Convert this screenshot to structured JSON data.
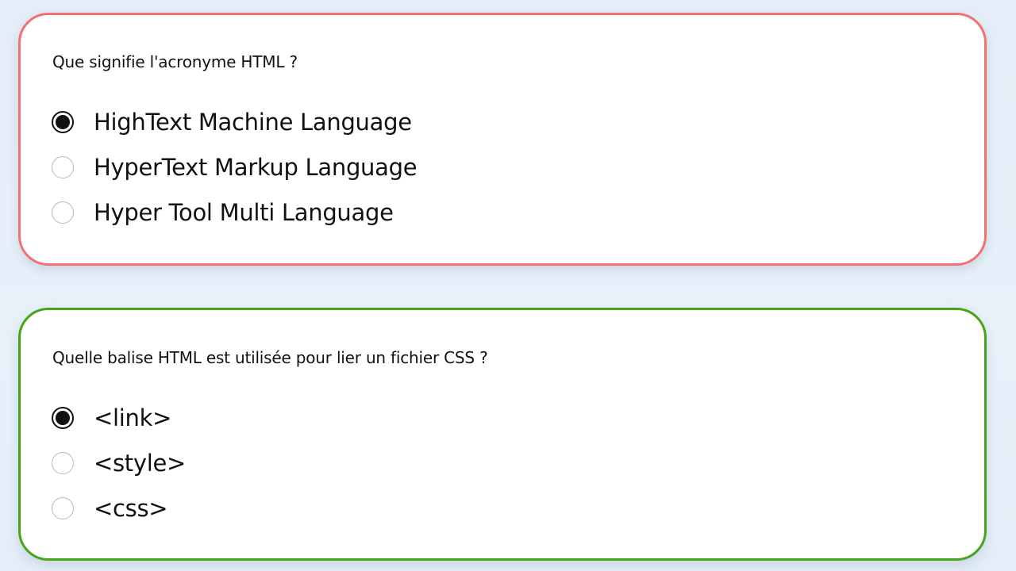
{
  "colors": {
    "incorrect_border": "#f07272",
    "correct_border": "#45a517",
    "page_background": "#e6f0f9"
  },
  "questions": [
    {
      "text": "Que signifie l'acronyme HTML ?",
      "status": "incorrect",
      "options": [
        {
          "label": "HighText Machine Language",
          "selected": true
        },
        {
          "label": "HyperText Markup Language",
          "selected": false
        },
        {
          "label": "Hyper Tool Multi Language",
          "selected": false
        }
      ]
    },
    {
      "text": "Quelle balise HTML est utilisée pour lier un fichier CSS ?",
      "status": "correct",
      "options": [
        {
          "label": "<link>",
          "selected": true
        },
        {
          "label": "<style>",
          "selected": false
        },
        {
          "label": "<css>",
          "selected": false
        }
      ]
    }
  ]
}
